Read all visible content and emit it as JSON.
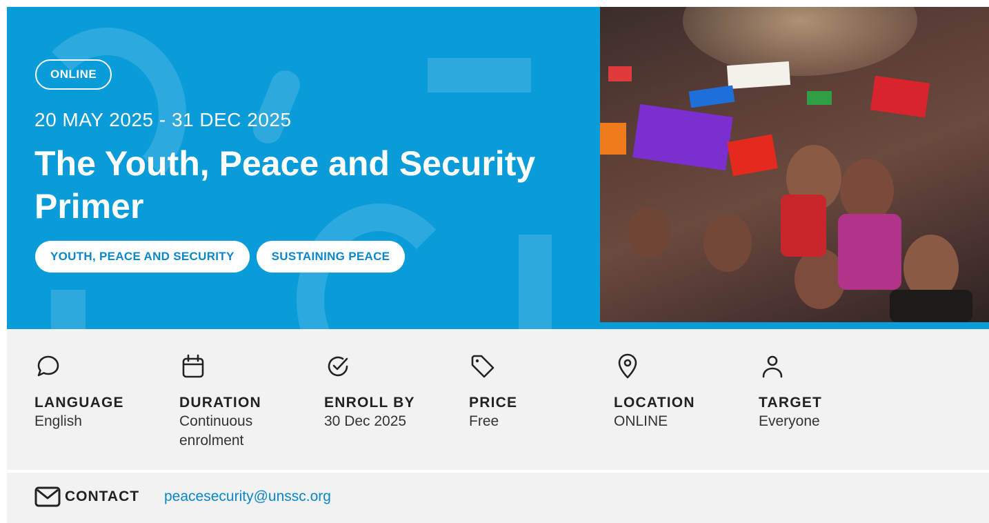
{
  "hero": {
    "badge": "ONLINE",
    "dates": "20 MAY 2025 - 31 DEC 2025",
    "title": "The Youth, Peace and Security Primer",
    "tags": [
      "YOUTH, PEACE AND SECURITY",
      "SUSTAINING PEACE"
    ],
    "background_color": "#0a9bd9"
  },
  "info": {
    "items": [
      {
        "icon": "chat-bubble-icon",
        "label": "LANGUAGE",
        "value": "English"
      },
      {
        "icon": "calendar-icon",
        "label": "DURATION",
        "value": "Continuous enrolment"
      },
      {
        "icon": "check-circle-icon",
        "label": "ENROLL BY",
        "value": "30 Dec 2025"
      },
      {
        "icon": "price-tag-icon",
        "label": "PRICE",
        "value": "Free"
      },
      {
        "icon": "map-pin-icon",
        "label": "LOCATION",
        "value": "ONLINE"
      },
      {
        "icon": "person-icon",
        "label": "TARGET",
        "value": "Everyone"
      }
    ]
  },
  "contact": {
    "icon": "envelope-icon",
    "label": "CONTACT",
    "email": "peacesecurity@unssc.org"
  },
  "colors": {
    "accent": "#0a9bd9",
    "link": "#0a87c9",
    "panel": "#f2f2f2"
  }
}
